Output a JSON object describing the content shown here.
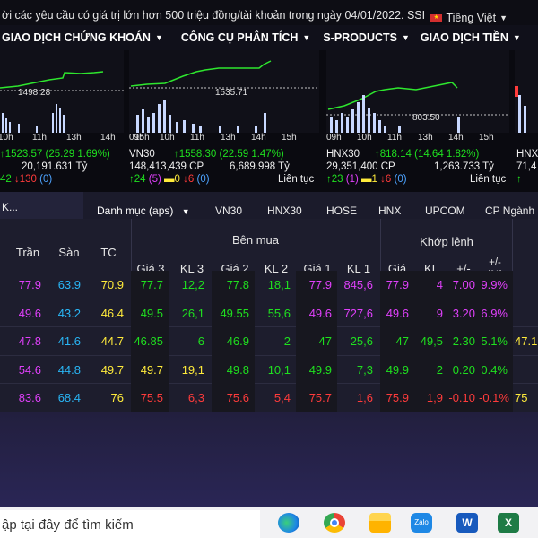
{
  "notice": {
    "text": "ời các yêu cầu có giá trị lớn hơn 500 triệu đồng/tài khoản trong ngày 04/01/2022. SSI",
    "language": "Tiếng Việt"
  },
  "nav": {
    "items": [
      "GIAO DỊCH CHỨNG KHOÁN",
      "CÔNG CỤ PHÂN TÍCH",
      "S-PRODUCTS",
      "GIAO DỊCH TIỀN"
    ]
  },
  "charts": [
    {
      "level": "1498.28",
      "index_line": "1523.57 (25.29 1.69%)",
      "value": "20,191.631 Tỷ",
      "stats": {
        "down": "130",
        "ref": "0"
      },
      "times": [
        "10h",
        "11h",
        "13h",
        "14h",
        "15h"
      ],
      "up_partial": "42"
    },
    {
      "name": "VN30",
      "level": "1535.71",
      "index_line": "1558.30 (22.59 1.47%)",
      "volume": "148,413,439 CP",
      "value": "6,689.998 Tỷ",
      "stats": {
        "up": "24",
        "ceil": "5",
        "ref": "0",
        "down": "6",
        "floor": "0"
      },
      "status": "Liên tục",
      "times": [
        "09h",
        "10h",
        "11h",
        "13h",
        "14h",
        "15h"
      ]
    },
    {
      "name": "HNX30",
      "level": "803.50",
      "index_line": "818.14 (14.64 1.82%)",
      "volume": "29,351,400 CP",
      "value": "1,263.733 Tỷ",
      "stats": {
        "up": "23",
        "ceil": "1",
        "ref": "1",
        "down": "6",
        "floor": "0"
      },
      "status": "Liên tục",
      "times": [
        "09h",
        "10h",
        "11h",
        "13h",
        "14h",
        "15h"
      ]
    },
    {
      "name": "HNX",
      "partial": "71,4"
    }
  ],
  "prev_status": "Liên tục",
  "tabs": {
    "search": "K...",
    "items": [
      "Danh mục (aps)",
      "VN30",
      "HNX30",
      "HOSE",
      "HNX",
      "UPCOM",
      "CP Ngành"
    ]
  },
  "table": {
    "headers": {
      "tran": "Trần",
      "san": "Sàn",
      "tc": "TC",
      "ben_mua": "Bên mua",
      "gia3": "Giá 3",
      "kl3": "KL 3",
      "gia2": "Giá 2",
      "kl2": "KL 2",
      "gia1": "Giá 1",
      "kl1": "KL 1",
      "khop_lenh": "Khớp lệnh",
      "gia": "Giá",
      "kl": "KL",
      "chg": "+/-",
      "pct": "+/- (%)"
    },
    "rows": [
      {
        "tran": "77.9",
        "san": "63.9",
        "tc": "70.9",
        "gia3": "77.7",
        "kl3": "12,2",
        "gia2": "77.8",
        "kl2": "18,1",
        "gia1": "77.9",
        "kl1": "845,6",
        "gia": "77.9",
        "kl": "4",
        "chg": "7.00",
        "pct": "9.9%",
        "extra": ""
      },
      {
        "tran": "49.6",
        "san": "43.2",
        "tc": "46.4",
        "gia3": "49.5",
        "kl3": "26,1",
        "gia2": "49.55",
        "kl2": "55,6",
        "gia1": "49.6",
        "kl1": "727,6",
        "gia": "49.6",
        "kl": "9",
        "chg": "3.20",
        "pct": "6.9%",
        "extra": ""
      },
      {
        "tran": "47.8",
        "san": "41.6",
        "tc": "44.7",
        "gia3": "46.85",
        "kl3": "6",
        "gia2": "46.9",
        "kl2": "2",
        "gia1": "47",
        "kl1": "25,6",
        "gia": "47",
        "kl": "49,5",
        "chg": "2.30",
        "pct": "5.1%",
        "extra": "47.1"
      },
      {
        "tran": "54.6",
        "san": "44.8",
        "tc": "49.7",
        "gia3": "49.7",
        "kl3": "19,1",
        "gia2": "49.8",
        "kl2": "10,1",
        "gia1": "49.9",
        "kl1": "7,3",
        "gia": "49.9",
        "kl": "2",
        "chg": "0.20",
        "pct": "0.4%",
        "extra": ""
      },
      {
        "tran": "83.6",
        "san": "68.4",
        "tc": "76",
        "gia3": "75.5",
        "kl3": "6,3",
        "gia2": "75.6",
        "kl2": "5,4",
        "gia1": "75.7",
        "kl1": "1,6",
        "gia": "75.9",
        "kl": "1,9",
        "chg": "-0.10",
        "pct": "-0.1%",
        "extra": "75"
      }
    ]
  },
  "taskbar": {
    "search_text": "ập tại đây để tìm kiếm",
    "icons": [
      "edge-icon",
      "chrome-icon",
      "explorer-icon",
      "zalo-icon",
      "word-icon",
      "excel-icon"
    ]
  },
  "colors": {
    "ceil": "#e040fb",
    "floor": "#29b6f6",
    "ref": "#ffeb3b",
    "up": "#1fe01f",
    "down": "#ff3b3b",
    "bg": "#1d1d2d"
  }
}
